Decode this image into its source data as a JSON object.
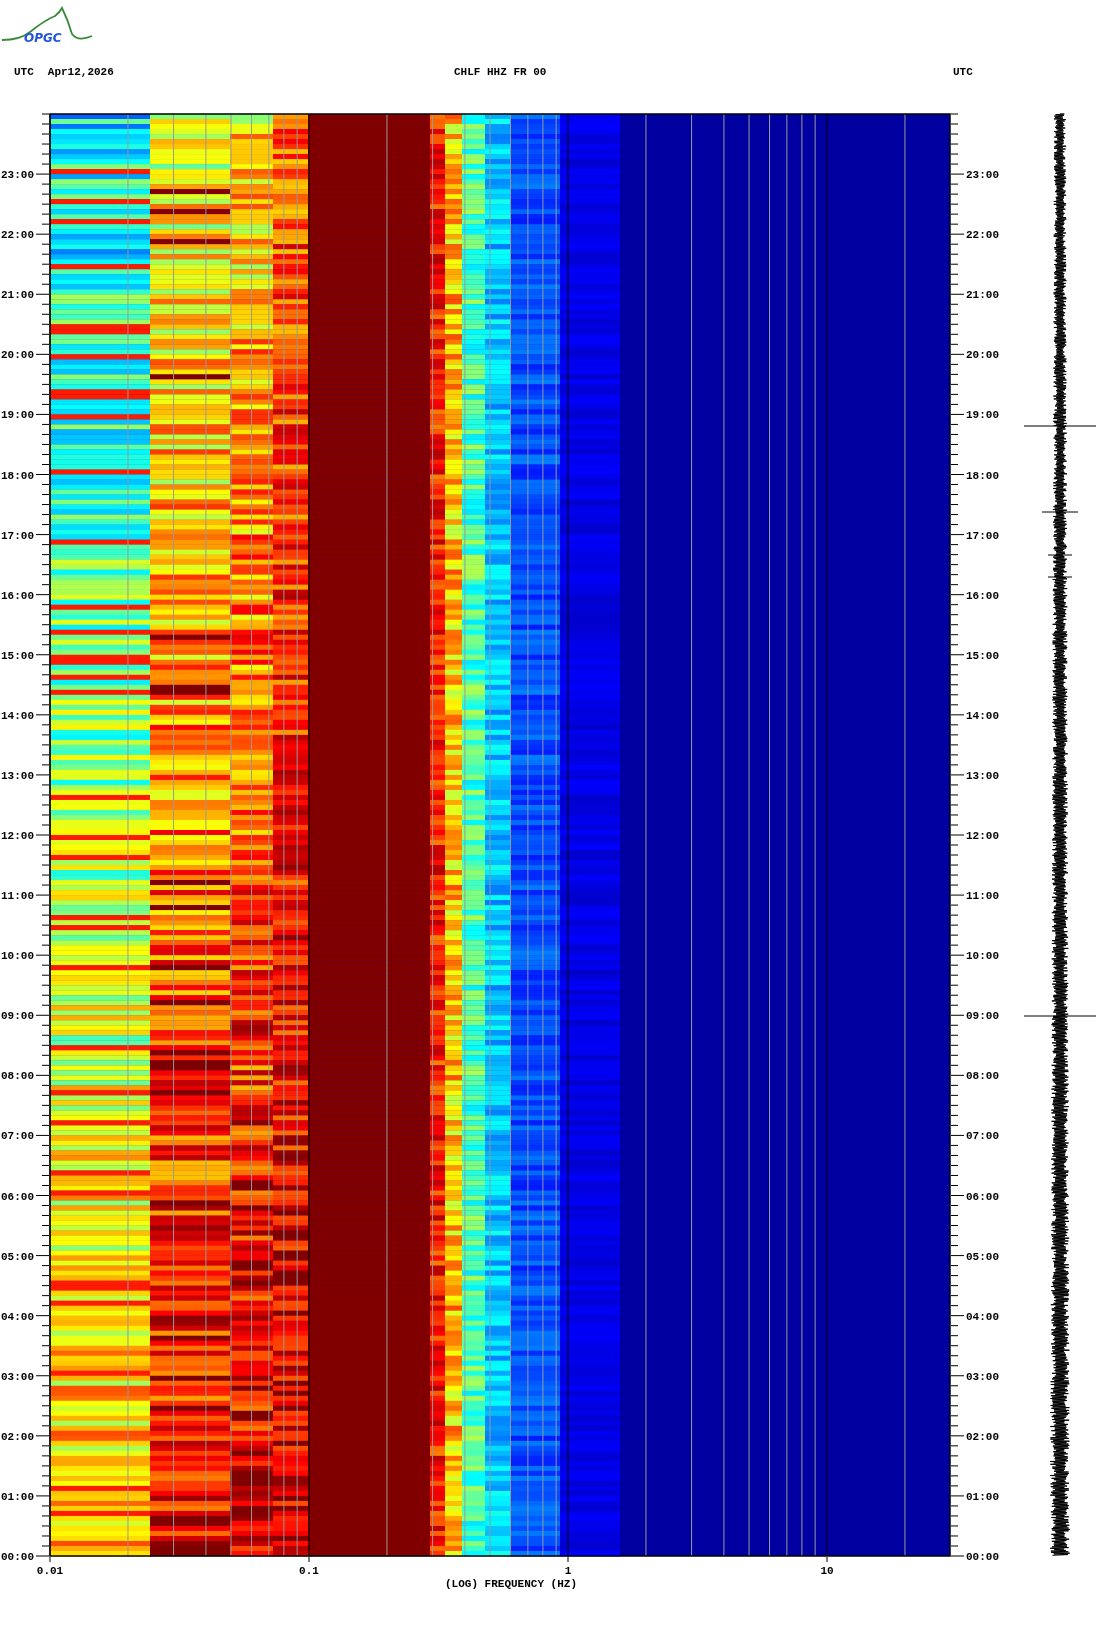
{
  "logo": {
    "text": "OPGC"
  },
  "header": {
    "left_label": "UTC",
    "date": "Apr12,2026",
    "station": "CHLF HHZ FR 00",
    "right_label": "UTC"
  },
  "left_time_ticks": [
    "23:00",
    "22:00",
    "21:00",
    "20:00",
    "19:00",
    "18:00",
    "17:00",
    "16:00",
    "15:00",
    "14:00",
    "13:00",
    "12:00",
    "11:00",
    "10:00",
    "09:00",
    "08:00",
    "07:00",
    "06:00",
    "05:00",
    "04:00",
    "03:00",
    "02:00",
    "01:00",
    "00:00"
  ],
  "right_time_ticks": [
    "23:00",
    "22:00",
    "21:00",
    "20:00",
    "19:00",
    "18:00",
    "17:00",
    "16:00",
    "15:00",
    "14:00",
    "13:00",
    "12:00",
    "11:00",
    "10:00",
    "09:00",
    "08:00",
    "07:00",
    "06:00",
    "05:00",
    "04:00",
    "03:00",
    "02:00",
    "01:00",
    "00:00"
  ],
  "frequency_axis": {
    "ticks": [
      "0.01",
      "0.1",
      "1",
      "10"
    ],
    "label": "(LOG) FREQUENCY (HZ)"
  }
}
